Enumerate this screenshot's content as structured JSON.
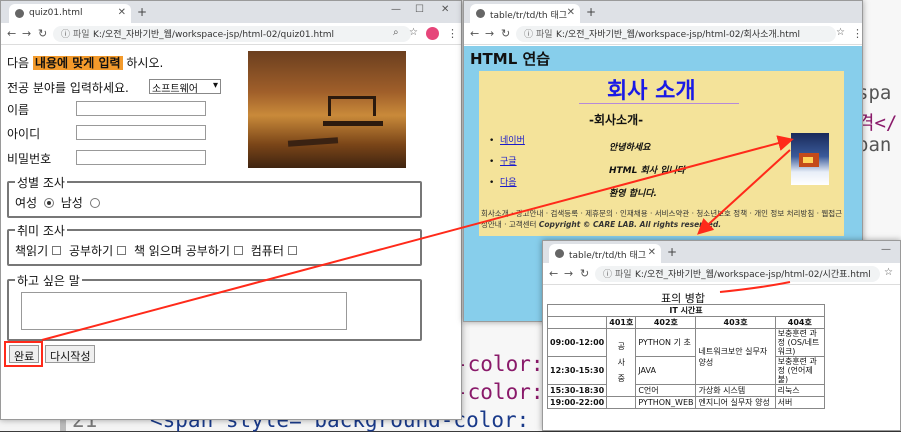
{
  "code_bg": {
    "lines": [
      "-color:",
      "-color:",
      "<span style= background-color:"
    ],
    "line_number": "21",
    "right_fragments": [
      "spa",
      "격</",
      "pan"
    ]
  },
  "win1": {
    "tab_title": "quiz01.html",
    "url_label": "파일",
    "url": "K:/오전_자바기반_웹/workspace-jsp/html-02/quiz01.html",
    "intro_prefix": "다음",
    "intro_highlight": "내용에 맞게 입력",
    "intro_suffix": "하시오.",
    "major_label": "전공 분야를 입력하세요.",
    "major_select": "소프트웨어",
    "name_label": "이름",
    "id_label": "아이디",
    "pw_label": "비밀번호",
    "gender_legend": "성별 조사",
    "gender_female": "여성",
    "gender_male": "남성",
    "hobby_legend": "취미 조사",
    "hobbies": [
      "책읽기",
      "공부하기",
      "책 읽으며 공부하기",
      "컴퓨터"
    ],
    "msg_legend": "하고 싶은 말",
    "submit": "완료",
    "reset": "다시작성"
  },
  "win2": {
    "tab_title": "table/tr/td/th 태그",
    "url_label": "파일",
    "url": "K:/오전_자바기반_웹/workspace-jsp/html-02/회사소개.html",
    "heading": "HTML 연습",
    "title": "회사 소개",
    "subtitle": "-회사소개-",
    "links": [
      "네이버",
      "구글",
      "다음"
    ],
    "lines": [
      "안녕하세요",
      "HTML 회사 입니다",
      "환영 합니다."
    ],
    "footer": "회사소개 · 광고안내 · 검색등록 · 제휴문의 · 인재채용 · 서비스약관 · 청소년보호 정책 · 개인 정보 처리방침 · 웹접근성안내 · 고객센터",
    "copyright": "Copyright © CARE LAB. All rights reserved."
  },
  "win3": {
    "tab_title": "table/tr/td/th 태그",
    "url_label": "파일",
    "url": "K:/오전_자바기반_웹/workspace-jsp/html-02/시간표.html",
    "title": "표의 병합",
    "caption": "IT 시간표",
    "rooms": [
      "401호",
      "402호",
      "403호",
      "404호"
    ],
    "times": [
      "09:00-12:00",
      "12:30-15:30",
      "15:30-18:30",
      "19:00-22:00"
    ],
    "vert": [
      "공",
      "사",
      "중"
    ],
    "c402": [
      "PYTHON 기 초",
      "JAVA",
      "C언어",
      "PYTHON_WEB"
    ],
    "c403a": "네트워크보안 실무자 양성",
    "c403b": "가상화 시스템",
    "c403c": "엔지니어 실무자 양성",
    "c404": [
      "보충훈련 과정 (OS/네트워크)",
      "보충훈련 과정 (언어제불)",
      "리눅스",
      "서버"
    ]
  },
  "colors": {
    "arrow": "#ff2a1a",
    "highlight": "#f39a2b",
    "yellow": "#f4e39a",
    "blue": "#87ceeb"
  }
}
